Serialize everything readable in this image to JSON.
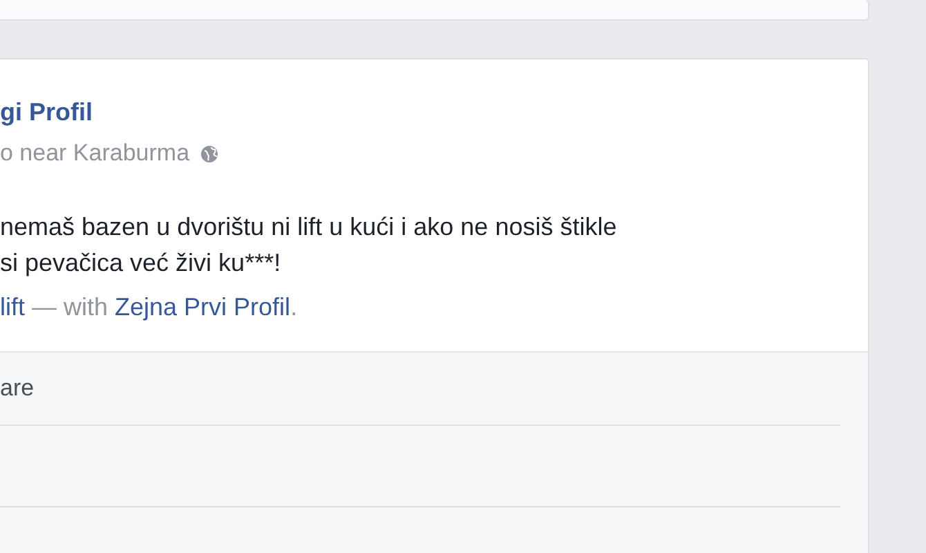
{
  "post": {
    "author": "gi Profil",
    "meta": "o near Karaburma",
    "text_lines": [
      "nemaš bazen u dvorištu ni lift u kući i ako ne nosiš štikle",
      "si pevačica već živi ku***!"
    ],
    "tag_line": {
      "place": "lift",
      "with": "— with",
      "friend": "Zejna Prvi Profil",
      "end": "."
    },
    "actions": [
      "are"
    ]
  }
}
